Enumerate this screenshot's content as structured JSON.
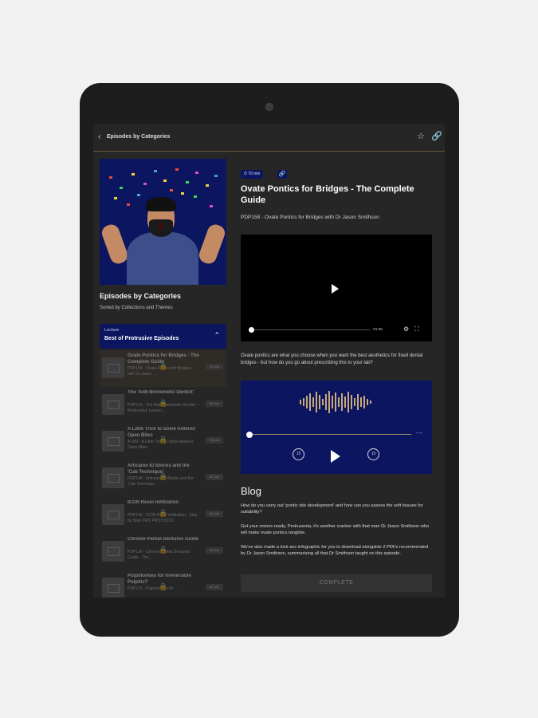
{
  "topbar": {
    "back_icon": "chevron-left-icon",
    "title": "Episodes by Categories",
    "star_icon": "star-icon",
    "link_icon": "link-icon"
  },
  "left": {
    "title": "Episodes by Categories",
    "subtitle": "Sorted by Collections and Themes",
    "collection": {
      "label": "Lecture",
      "name": "Best of Protrusive Episodes"
    },
    "episodes": [
      {
        "title": "Ovate Pontics for Bridges - The Complete Guide",
        "sub": "PDP158 - Ovate Pontics for Bridges with Dr Jason ...",
        "time": "70 min"
      },
      {
        "title": "The 'Anti-Biomimetic Dentist'",
        "sub": "PDP153 - The Anti-Biomimetic Dentist' – Restorative Lesson...",
        "time": "60 min"
      },
      {
        "title": "A Little Trick to Solve Anterior Open Bites",
        "sub": "A-003 - A Little Trick to Solve Anterior Open Bites",
        "time": "15 min"
      },
      {
        "title": "Articaine ID Blocks and the 'Cab Technique'",
        "sub": "PDP148 - Articaine ID Blocks and the 'Cab Technique",
        "time": "60 min"
      },
      {
        "title": "ICON Resin Infiltration",
        "sub": "PDP146 - ICON Resin Infiltration - Step by Step PRO PROTOCOL",
        "time": "60 min"
      },
      {
        "title": "Chrome Partial Dentures Guide",
        "sub": "PDP136 - Chrome Partial Dentures Guide - The ...",
        "time": "60 min"
      },
      {
        "title": "Pulpotomies for Irreversible Pulpitis?",
        "sub": "PDP125 - Pulpotomies for ...",
        "time": "60 min"
      }
    ]
  },
  "episode": {
    "badge": "70 min",
    "title": "Ovate Pontics for Bridges - The Complete Guide",
    "subtitle": "PDP158 - Ovate Pontics for Bridges with Dr Jason Smithson",
    "video_time": "-01:05",
    "description": "Ovate pontics are what you choose when you want the best aesthetics for fixed dental bridges - but how do you go about prescribing this to your lab?",
    "audio_time": "--:--",
    "skip_back": "15",
    "skip_fwd": "15"
  },
  "blog": {
    "heading": "Blog",
    "p1": "How do you carry out 'pontic site development' and how can you assess the soft tissues for suitability?",
    "p2": "Get your onions ready, Protrusenta, it's another cracker with that man Dr Jason Smithson who will make ovate pontics tangible.",
    "p3": "We've also made a kick-ass infographic for you to download alongside 2 PDFs recommended by Dr Jason Smithson, summarising all that Dr Smithson taught on this episode.",
    "complete_label": "COMPLETE"
  }
}
